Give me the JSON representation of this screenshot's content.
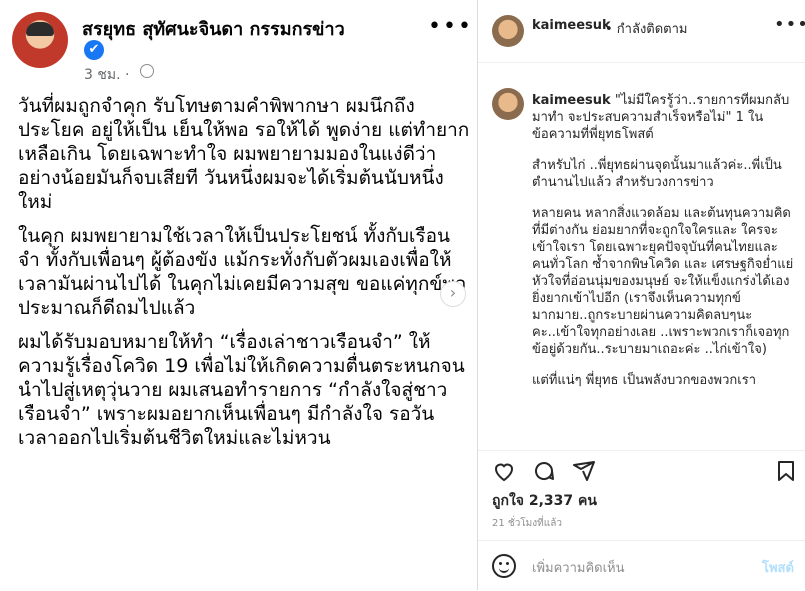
{
  "facebook": {
    "name": "สรยุทธ สุทัศนะจินดา กรรมกรข่าว",
    "verified_icon": "✔",
    "time": "3 ชม. ·",
    "more": "•••",
    "paragraphs": [
      "วันที่ผมถูกจำคุก รับโทษตามคำพิพากษา ผมนึกถึงประโยค อยู่ให้เป็น เย็นให้พอ รอให้ได้ พูดง่าย แต่ทำยากเหลือเกิน โดยเฉพาะทำใจ ผมพยายามมองในแง่ดีว่า อย่างน้อยมันก็จบเสียที วันหนึ่งผมจะได้เริ่มต้นนับหนึ่งใหม่",
      "ในคุก ผมพยายามใช้เวลาให้เป็นประโยชน์ ทั้งกับเรือนจำ ทั้งกับเพื่อนๆ ผู้ต้องขัง แม้กระทั่งกับตัวผมเองเพื่อให้เวลามันผ่านไปได้ ในคุกไม่เคยมีความสุข ขอแค่ทุกข์พอประมาณก็ดีถมไปแล้ว",
      "ผมได้รับมอบหมายให้ทำ “เรื่องเล่าชาวเรือนจำ” ให้ความรู้เรื่องโควิด 19 เพื่อไม่ให้เกิดความตื่นตระหนกจนนำไปสู่เหตุวุ่นวาย ผมเสนอทำรายการ “กำลังใจสู่ชาวเรือนจำ” เพราะผมอยากเห็นเพื่อนๆ มีกำลังใจ รอวันเวลาออกไปเริ่มต้นชีวิตใหม่และไม่หวน"
    ]
  },
  "instagram": {
    "username": "kaimeesuk",
    "follow_status": "• กำลังติดตาม",
    "more": "•••",
    "caption_user": "kaimeesuk",
    "caption_paragraphs": [
      "\"ไม่มีใครรู้ว่า..รายการที่ผมกลับมาทำ จะประสบความสำเร็จหรือไม่\" 1 ในข้อความที่พี่ยุทธโพสต์",
      "สำหรับไก่ ..พี่ยุทธผ่านจุดนั้นมาแล้วค่ะ..พี่เป็นตำนานไปแล้ว สำหรับวงการข่าว",
      "หลายคน หลากสิ่งแวดล้อม และต้นทุนความคิดที่มีต่างกัน ย่อมยากที่จะถูกใจใครและ ใครจะเข้าใจเรา โดยเฉพาะยุคปัจจุบันที่คนไทยและคนทั่วโลก ซ้ำจากพิษโควิด และ เศรษฐกิจย่ำแย่ หัวใจที่อ่อนนุ่มของมนุษย์ จะให้แข็งแกร่งได้เอง ยิ่งยากเข้าไปอีก (เราจึงเห็นความทุกข์มากมาย..ถูกระบายผ่านความคิดลบๆนะคะ..เข้าใจทุกอย่างเลย ..เพราะพวกเราก็เจอทุกข้อยู่ด้วยกัน..ระบายมาเถอะค่ะ ..ไก่เข้าใจ)",
      "แต่ที่แน่ๆ พี่ยุทธ เป็นพลังบวกของพวกเรา"
    ],
    "likes": "ถูกใจ 2,337 คน",
    "time_ago": "21 ชั่วโมงที่แล้ว",
    "comment_placeholder": "เพิ่มความคิดเห็น",
    "post_label": "โพสต์"
  }
}
